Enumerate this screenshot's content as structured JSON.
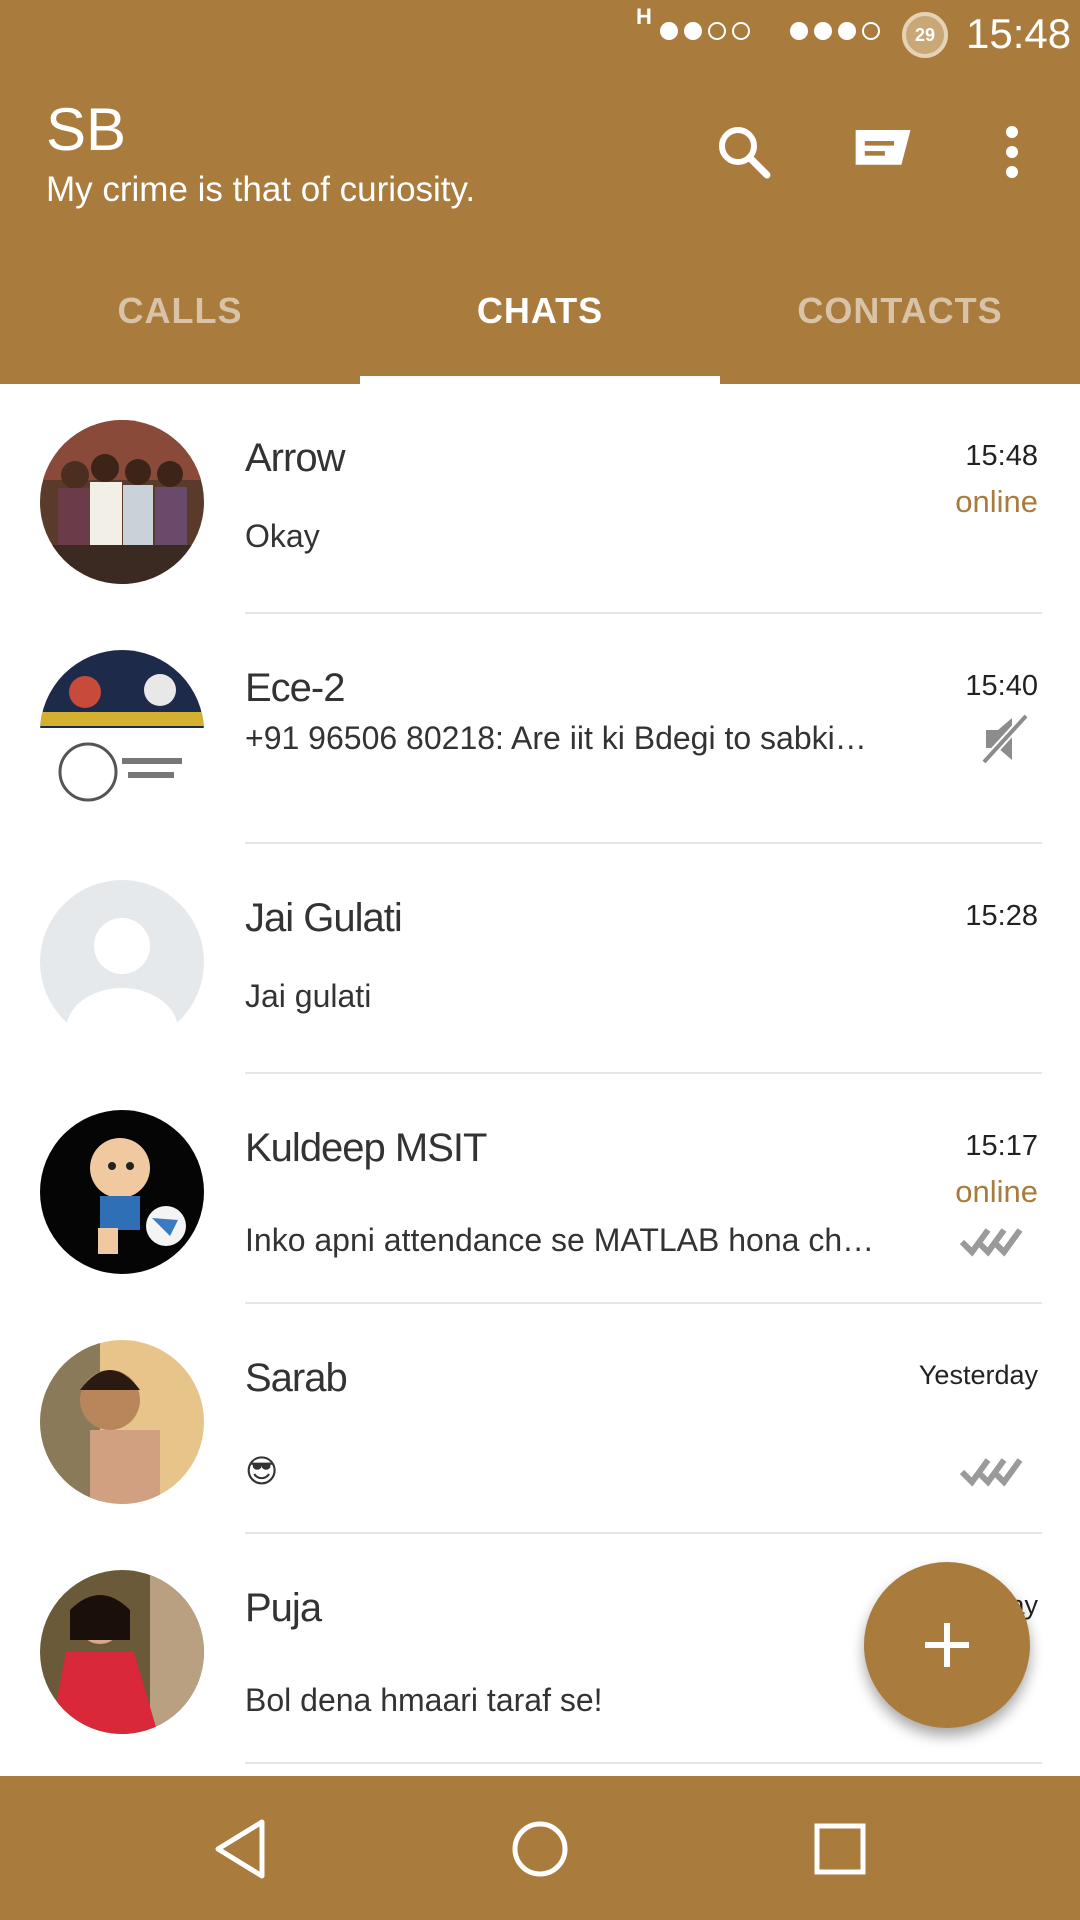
{
  "status_bar": {
    "network_type": "H",
    "battery_level": "29",
    "time": "15:48",
    "signal1": [
      true,
      true,
      false,
      false
    ],
    "signal2": [
      true,
      true,
      true,
      false
    ]
  },
  "header": {
    "title": "SB",
    "subtitle": "My crime is that of curiosity.",
    "icons": [
      "search-icon",
      "new-chat-icon",
      "more-options-icon"
    ]
  },
  "tabs": [
    {
      "label": "CALLS",
      "active": false
    },
    {
      "label": "CHATS",
      "active": true
    },
    {
      "label": "CONTACTS",
      "active": false
    }
  ],
  "chats": [
    {
      "name": "Arrow",
      "time": "15:48",
      "status": "online",
      "preview": "Okay"
    },
    {
      "name": "Ece-2",
      "time": "15:40",
      "preview": "+91 96506 80218: Are iit ki Bdegi to sabki…",
      "icon": "muted-icon"
    },
    {
      "name": "Jai Gulati",
      "time": "15:28",
      "preview": "Jai gulati"
    },
    {
      "name": "Kuldeep MSIT",
      "time": "15:17",
      "status": "online",
      "preview": "Inko apni attendance se MATLAB hona ch…",
      "icon": "read-ticks-icon"
    },
    {
      "name": "Sarab",
      "time": "Yesterday",
      "preview": "😎",
      "icon": "read-ticks-icon"
    },
    {
      "name": "Puja",
      "time": "Yesterday",
      "preview": "Bol dena hmaari taraf se!"
    }
  ],
  "colors": {
    "accent": "#a97b3d",
    "text": "#333333",
    "divider": "#e6e6e6"
  }
}
